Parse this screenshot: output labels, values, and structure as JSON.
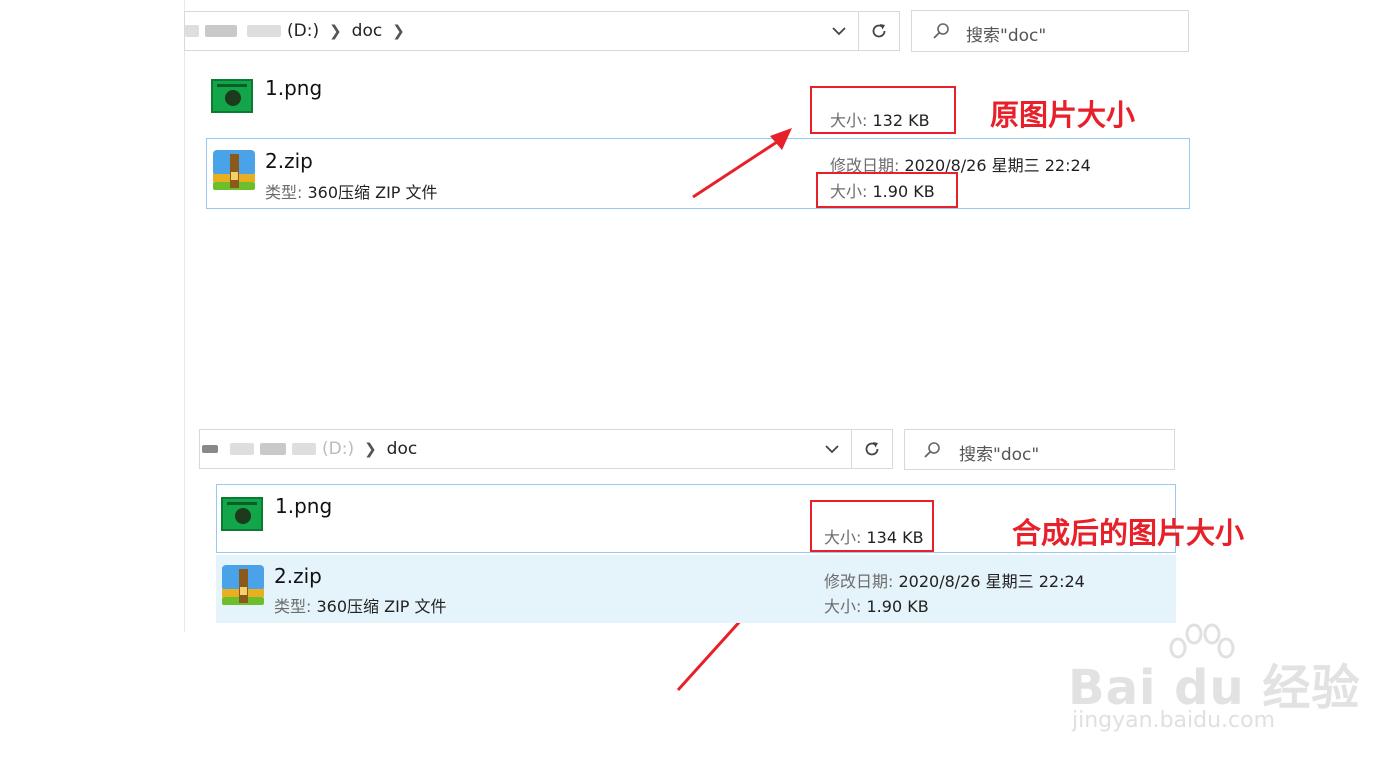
{
  "top_panel": {
    "breadcrumb": {
      "drive": "(D:)",
      "folder": "doc"
    },
    "search_placeholder": "搜索\"doc\"",
    "files": [
      {
        "name": "1.png",
        "size_label": "大小:",
        "size_value": "132 KB"
      },
      {
        "name": "2.zip",
        "type_label": "类型:",
        "type_value": "360压缩 ZIP 文件",
        "modified_label": "修改日期:",
        "modified_value": "2020/8/26 星期三 22:24",
        "size_label": "大小:",
        "size_value": "1.90 KB"
      }
    ],
    "annotation": "原图片大小"
  },
  "bottom_panel": {
    "breadcrumb": {
      "drive": "(D:)",
      "folder": "doc"
    },
    "search_placeholder": "搜索\"doc\"",
    "files": [
      {
        "name": "1.png",
        "size_label": "大小:",
        "size_value": "134 KB"
      },
      {
        "name": "2.zip",
        "type_label": "类型:",
        "type_value": "360压缩 ZIP 文件",
        "modified_label": "修改日期:",
        "modified_value": "2020/8/26 星期三 22:24",
        "size_label": "大小:",
        "size_value": "1.90 KB"
      }
    ],
    "annotation": "合成后的图片大小"
  },
  "watermark": {
    "brand": "Bai du 经验",
    "url": "jingyan.baidu.com"
  },
  "colors": {
    "annotation_red": "#e8202a",
    "selection_fill": "#e5f3fb",
    "selection_border": "#99c9ef"
  }
}
